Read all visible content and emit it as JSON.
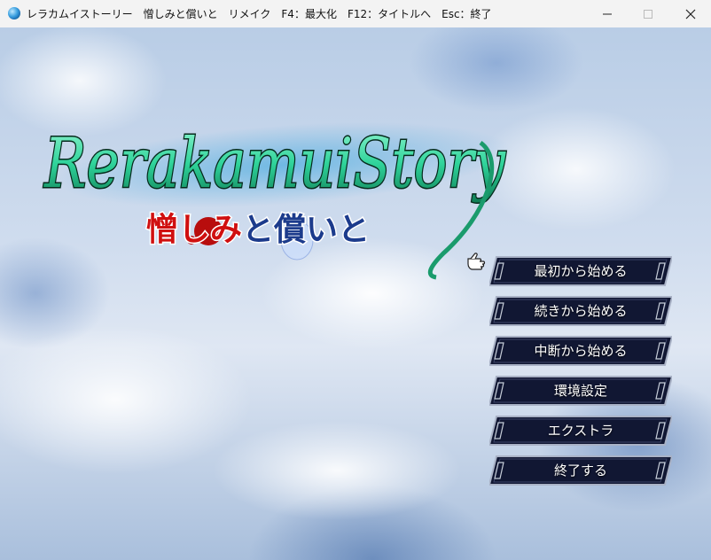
{
  "window": {
    "title": "レラカムイストーリー　憎しみと償いと　リメイク　F4：最大化　F12：タイトルへ　Esc：終了",
    "controls": [
      "minimize-icon",
      "maximize-icon",
      "close-icon"
    ]
  },
  "logo": {
    "title_text": "RerakamuiStory",
    "subtitle_part1": "憎しみ",
    "subtitle_part2": "と償いと"
  },
  "menu": {
    "items": [
      {
        "label": "最初から始める"
      },
      {
        "label": "続きから始める"
      },
      {
        "label": "中断から始める"
      },
      {
        "label": "環境設定"
      },
      {
        "label": "エクストラ"
      },
      {
        "label": "終了する"
      }
    ],
    "selected_index": 0,
    "cursor_icon": "pointing-hand-icon"
  },
  "colors": {
    "logo_green": "#2fd39a",
    "subtitle_red": "#d01010",
    "subtitle_blue": "#1c3b8c",
    "button_dark": "#101530",
    "button_frame": "#9aa4b8"
  }
}
